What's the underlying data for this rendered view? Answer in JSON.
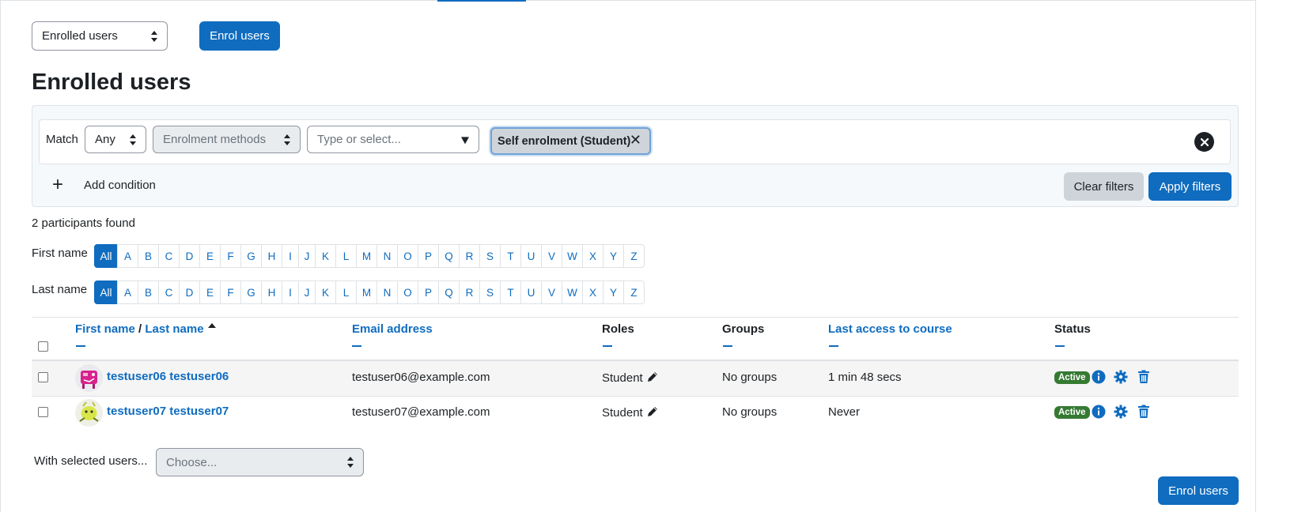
{
  "top": {
    "view_select": "Enrolled users",
    "enrol_button": "Enrol users"
  },
  "page": {
    "title": "Enrolled users"
  },
  "filter": {
    "match_label": "Match",
    "match_value": "Any",
    "type_select": "Enrolment methods",
    "value_placeholder": "Type or select...",
    "selected_tag": "Self enrolment (Student)",
    "tag_remove": "✕",
    "add_condition": "Add condition",
    "clear_filters": "Clear filters",
    "apply_filters": "Apply filters"
  },
  "summary": {
    "found": "2 participants found"
  },
  "initials": {
    "first_label": "First name",
    "last_label": "Last name",
    "letters": [
      "All",
      "A",
      "B",
      "C",
      "D",
      "E",
      "F",
      "G",
      "H",
      "I",
      "J",
      "K",
      "L",
      "M",
      "N",
      "O",
      "P",
      "Q",
      "R",
      "S",
      "T",
      "U",
      "V",
      "W",
      "X",
      "Y",
      "Z"
    ],
    "first_selected": "All",
    "last_selected": "All"
  },
  "table": {
    "headers": {
      "first_name": "First name",
      "separator": " / ",
      "last_name": "Last name",
      "email": "Email address",
      "roles": "Roles",
      "groups": "Groups",
      "last_access": "Last access to course",
      "status": "Status"
    },
    "rows": [
      {
        "name": "testuser06 testuser06",
        "email": "testuser06@example.com",
        "role": "Student",
        "groups": "No groups",
        "last_access": "1 min 48 secs",
        "status": "Active"
      },
      {
        "name": "testuser07 testuser07",
        "email": "testuser07@example.com",
        "role": "Student",
        "groups": "No groups",
        "last_access": "Never",
        "status": "Active"
      }
    ]
  },
  "bulk": {
    "label": "With selected users...",
    "select_placeholder": "Choose..."
  },
  "footer": {
    "enrol_button": "Enrol users"
  },
  "colors": {
    "primary": "#0f6cbf",
    "success": "#357a32",
    "secondary": "#ced4da"
  },
  "icons": [
    "info-icon",
    "gear-icon",
    "trash-icon",
    "pencil-icon",
    "sort-up-icon",
    "plus-icon",
    "close-icon"
  ]
}
